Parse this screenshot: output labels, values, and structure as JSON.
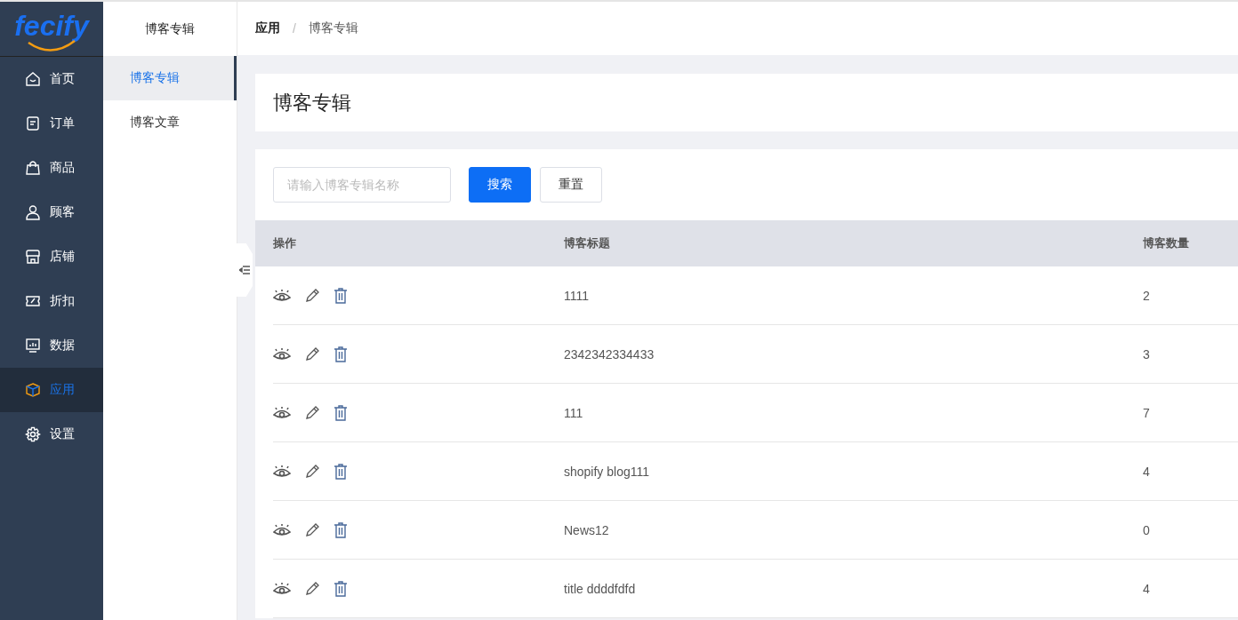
{
  "logo": {
    "text": "fecify"
  },
  "nav": [
    {
      "label": "首页",
      "selected": false
    },
    {
      "label": "订单",
      "selected": false
    },
    {
      "label": "商品",
      "selected": false
    },
    {
      "label": "顾客",
      "selected": false
    },
    {
      "label": "店铺",
      "selected": false
    },
    {
      "label": "折扣",
      "selected": false
    },
    {
      "label": "数据",
      "selected": false
    },
    {
      "label": "应用",
      "selected": true
    },
    {
      "label": "设置",
      "selected": false
    }
  ],
  "subnav": {
    "title": "博客专辑",
    "items": [
      {
        "label": "博客专辑",
        "selected": true
      },
      {
        "label": "博客文章",
        "selected": false
      }
    ]
  },
  "breadcrumb": [
    "应用",
    "博客专辑"
  ],
  "breadcrumb_separator": "/",
  "page_title": "博客专辑",
  "search": {
    "placeholder": "请输入博客专辑名称",
    "buttons": [
      "搜索",
      "重置"
    ]
  },
  "table": {
    "columns": [
      "操作",
      "博客标题",
      "博客数量"
    ],
    "rows": [
      {
        "title": "1111",
        "count": "2"
      },
      {
        "title": "2342342334433",
        "count": "3"
      },
      {
        "title": "111",
        "count": "7"
      },
      {
        "title": "shopify blog111",
        "count": "4"
      },
      {
        "title": "News12",
        "count": "0"
      },
      {
        "title": "title ddddfdfd",
        "count": "4"
      }
    ]
  }
}
